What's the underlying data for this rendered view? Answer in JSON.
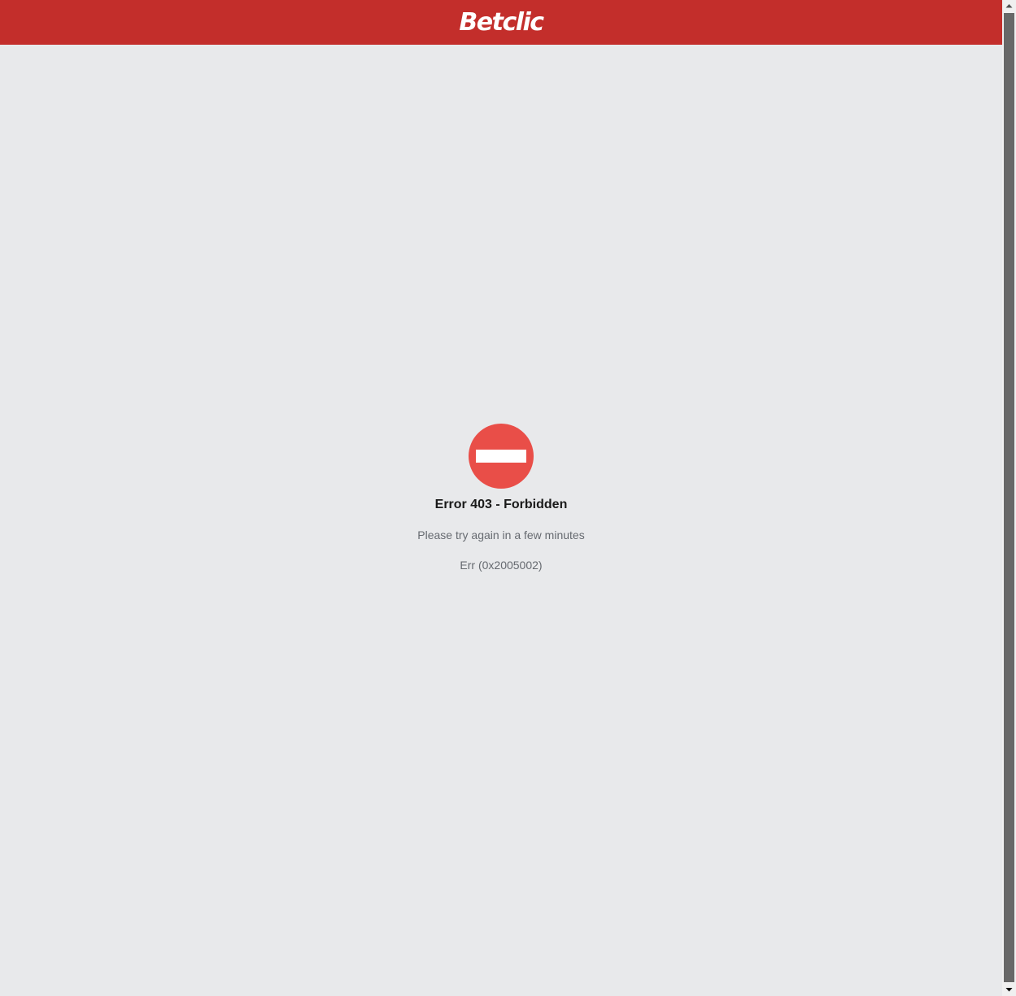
{
  "header": {
    "logo_text": "Betclic",
    "background_color": "#c32e2b"
  },
  "error": {
    "icon": "no-entry-icon",
    "icon_color": "#e94e48",
    "title": "Error 403 - Forbidden",
    "message": "Please try again in a few minutes",
    "code": "Err (0x2005002)"
  },
  "scrollbar": {
    "up_icon": "scroll-up-arrow-icon",
    "down_icon": "scroll-down-arrow-icon"
  }
}
